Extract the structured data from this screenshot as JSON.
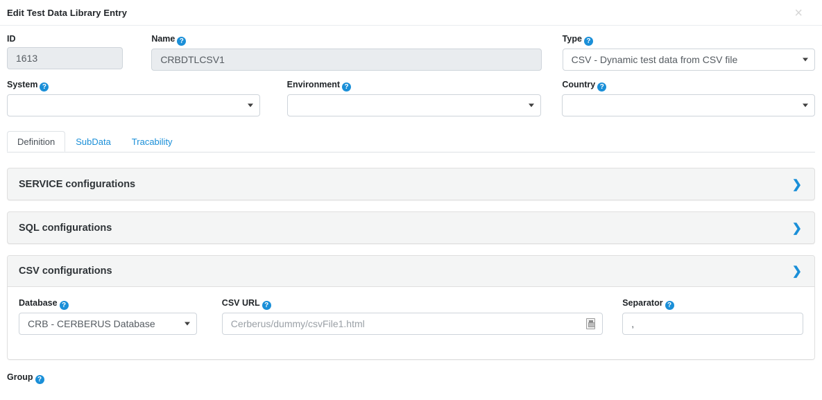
{
  "modal": {
    "title": "Edit Test Data Library Entry",
    "close_label": "×",
    "close_icon": "close-icon"
  },
  "form": {
    "id": {
      "label": "ID",
      "value": "1613",
      "has_help": false,
      "disabled": true
    },
    "name": {
      "label": "Name",
      "value": "CRBDTLCSV1",
      "has_help": true,
      "disabled": true
    },
    "type": {
      "label": "Type",
      "value": "CSV - Dynamic test data from CSV file",
      "has_help": true
    },
    "system": {
      "label": "System",
      "value": "",
      "has_help": true
    },
    "environment": {
      "label": "Environment",
      "value": "",
      "has_help": true
    },
    "country": {
      "label": "Country",
      "value": "",
      "has_help": true
    }
  },
  "tabs": [
    {
      "label": "Definition",
      "active": true
    },
    {
      "label": "SubData",
      "active": false
    },
    {
      "label": "Tracability",
      "active": false
    }
  ],
  "panels": [
    {
      "title": "SERVICE configurations",
      "expanded": false,
      "chevron": "chevron-right-icon"
    },
    {
      "title": "SQL configurations",
      "expanded": false,
      "chevron": "chevron-right-icon"
    },
    {
      "title": "CSV configurations",
      "expanded": true,
      "chevron": "chevron-right-icon"
    }
  ],
  "csv": {
    "database": {
      "label": "Database",
      "value": "CRB - CERBERUS Database",
      "has_help": true
    },
    "csv_url": {
      "label": "CSV URL",
      "value": "",
      "placeholder": "Cerberus/dummy/csvFile1.html",
      "has_help": true,
      "icon": "file-browse-icon"
    },
    "separator": {
      "label": "Separator",
      "value": ",",
      "has_help": true
    }
  },
  "group": {
    "label": "Group",
    "has_help": true
  },
  "colors": {
    "accent": "#1a8fd8",
    "panel_bg": "#f4f5f5",
    "border": "#ced4da",
    "disabled_bg": "#e9ecef",
    "text": "#212529"
  },
  "help_glyph": "?"
}
